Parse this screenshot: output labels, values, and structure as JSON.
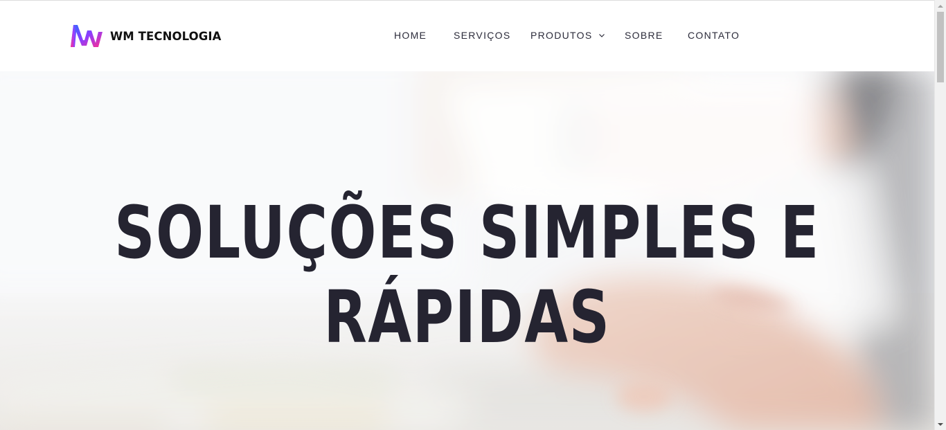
{
  "brand": {
    "name": "WM TECNOLOGIA",
    "logo_icon": "wm-logo-icon"
  },
  "nav": {
    "items": [
      {
        "label": "HOME"
      },
      {
        "label": "SERVIÇOS"
      },
      {
        "label": "PRODUTOS",
        "has_dropdown": true,
        "icon": "chevron-down-icon"
      },
      {
        "label": "SOBRE"
      },
      {
        "label": "CONTATO"
      }
    ]
  },
  "hero": {
    "title_line1": "SOLUÇÕES SIMPLES E",
    "title_line2": "RÁPIDAS"
  },
  "colors": {
    "text_dark": "#252431",
    "nav_text": "#2b2b3a",
    "logo_gradient": [
      "#2a6bff",
      "#8b3dff",
      "#ff2d8f"
    ]
  }
}
